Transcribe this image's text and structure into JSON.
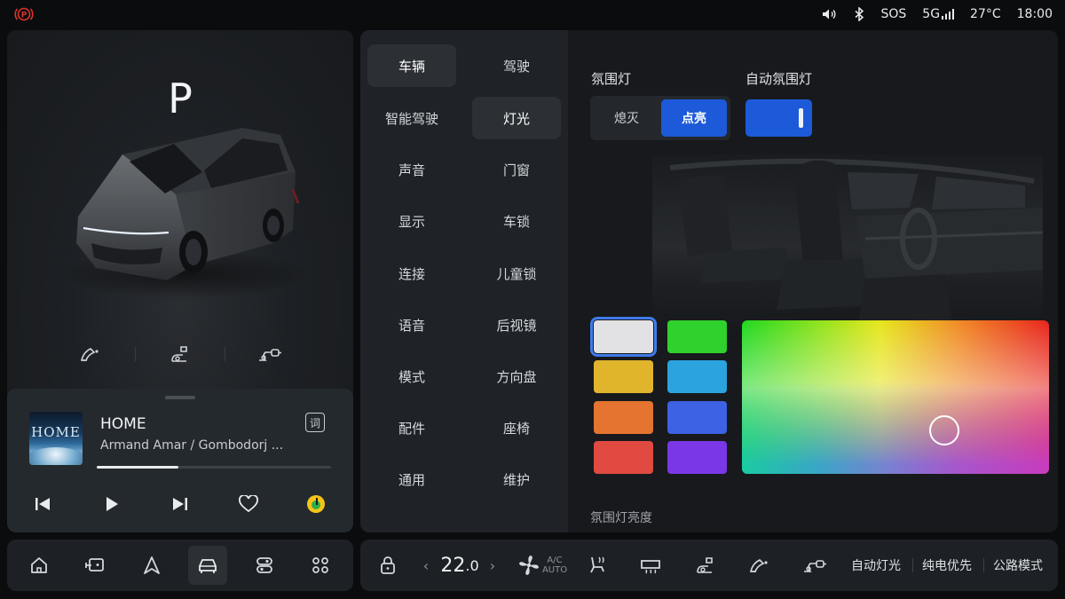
{
  "status": {
    "sos": "SOS",
    "network": "5G",
    "temperature": "27°C",
    "time": "18:00"
  },
  "car": {
    "gear": "P",
    "quick_icons": [
      "door-open-icon",
      "charging-port-icon",
      "tow-hook-icon"
    ]
  },
  "media": {
    "album_title": "HOME",
    "title": "HOME",
    "artist": "Armand Amar / Gombodorj ...",
    "lyrics_label": "词",
    "progress": 0.35
  },
  "menu": {
    "items": [
      {
        "label": "车辆",
        "active": true
      },
      {
        "label": "驾驶",
        "active": false
      },
      {
        "label": "智能驾驶",
        "active": false
      },
      {
        "label": "灯光",
        "active": true
      },
      {
        "label": "声音",
        "active": false
      },
      {
        "label": "门窗",
        "active": false
      },
      {
        "label": "显示",
        "active": false
      },
      {
        "label": "车锁",
        "active": false
      },
      {
        "label": "连接",
        "active": false
      },
      {
        "label": "儿童锁",
        "active": false
      },
      {
        "label": "语音",
        "active": false
      },
      {
        "label": "后视镜",
        "active": false
      },
      {
        "label": "模式",
        "active": false
      },
      {
        "label": "方向盘",
        "active": false
      },
      {
        "label": "配件",
        "active": false
      },
      {
        "label": "座椅",
        "active": false
      },
      {
        "label": "通用",
        "active": false
      },
      {
        "label": "维护",
        "active": false
      }
    ]
  },
  "lighting": {
    "ambient_label": "氛围灯",
    "auto_ambient_label": "自动氛围灯",
    "off_label": "熄灭",
    "on_label": "点亮",
    "ambient_state": "on",
    "auto_ambient_enabled": true,
    "brightness_label": "氛围灯亮度",
    "swatches": [
      {
        "color": "#e2e2e4",
        "selected": true
      },
      {
        "color": "#2fd12c",
        "selected": false
      },
      {
        "color": "#e0b52c",
        "selected": false
      },
      {
        "color": "#2ba3df",
        "selected": false
      },
      {
        "color": "#e47430",
        "selected": false
      },
      {
        "color": "#3d62e3",
        "selected": false
      },
      {
        "color": "#e04a40",
        "selected": false
      },
      {
        "color": "#7a37e6",
        "selected": false
      }
    ]
  },
  "dock": {
    "left_items": [
      "home-icon",
      "screen-cast-icon",
      "navigation-icon",
      "vehicle-icon",
      "controls-icon",
      "apps-icon"
    ],
    "active_index": 3,
    "temp_integer": "22",
    "temp_decimal": ".0",
    "temp_left_arrow": "‹",
    "temp_right_arrow": "›",
    "ac_line1": "A/C",
    "ac_line2": "AUTO",
    "auto_lights": "自动灯光",
    "ev_priority": "纯电优先",
    "road_mode": "公路模式"
  },
  "colors": {
    "accent": "#1d5ad9",
    "panel": "#1d2025",
    "brake_warning": "#d9342b"
  }
}
